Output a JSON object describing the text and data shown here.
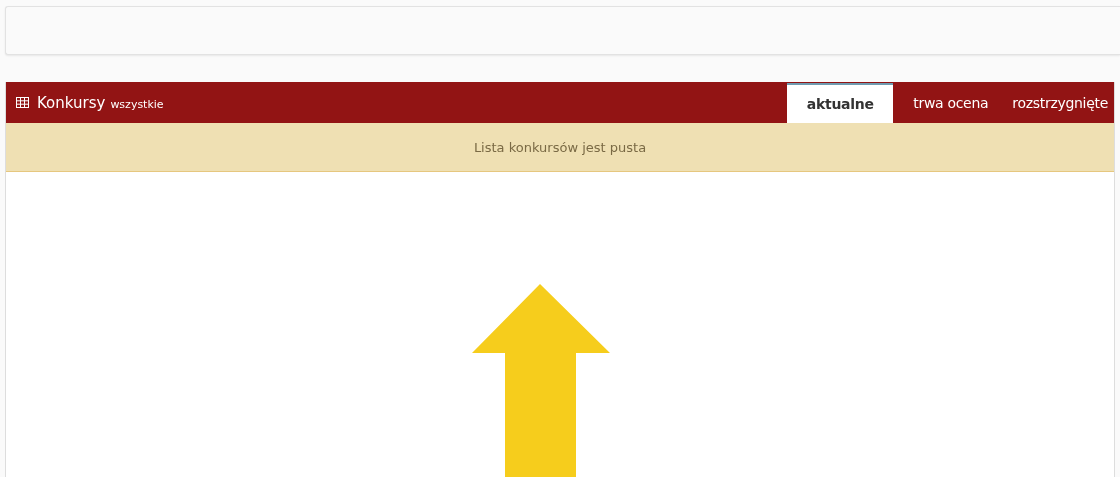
{
  "panel": {
    "title": "Konkursy",
    "subtitle": "wszystkie",
    "tabs": [
      {
        "label": "aktualne",
        "selected": true
      },
      {
        "label": "trwa ocena",
        "selected": false
      },
      {
        "label": "rozstrzygnięte",
        "selected": false
      }
    ],
    "alert": "Lista konkursów jest pusta"
  }
}
